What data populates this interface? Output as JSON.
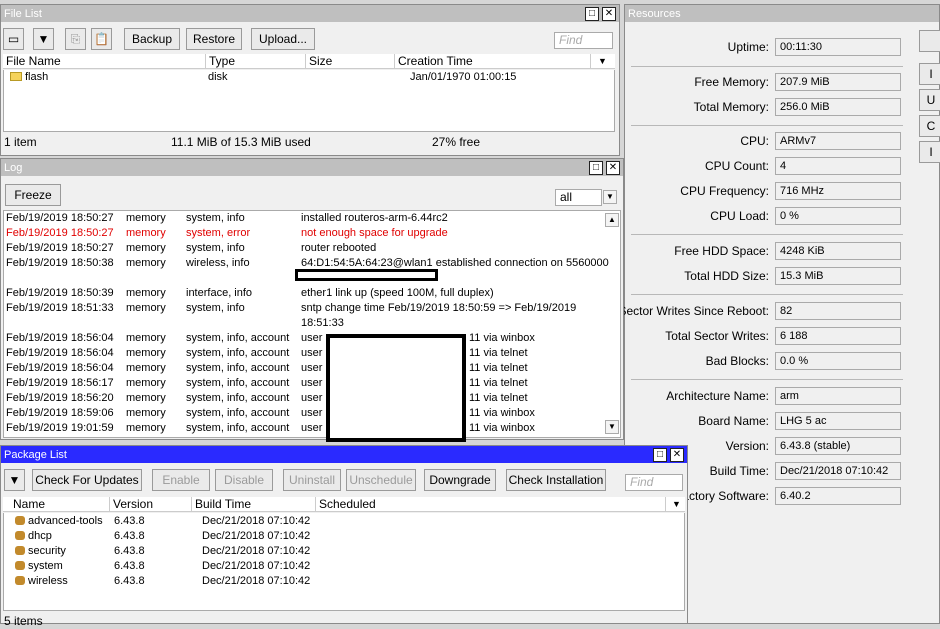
{
  "file_list": {
    "title": "File List",
    "buttons": {
      "backup": "Backup",
      "restore": "Restore",
      "upload": "Upload..."
    },
    "find_placeholder": "Find",
    "columns": [
      "File Name",
      "Type",
      "Size",
      "Creation Time"
    ],
    "rows": [
      {
        "name": "flash",
        "type": "disk",
        "size": "",
        "time": "Jan/01/1970 01:00:15"
      }
    ],
    "status": {
      "items": "1 item",
      "used": "11.1 MiB of 15.3 MiB used",
      "free": "27% free"
    }
  },
  "log": {
    "title": "Log",
    "freeze": "Freeze",
    "filter": "all",
    "rows": [
      {
        "time": "Feb/19/2019 18:50:27",
        "buffer": "memory",
        "topics": "system, info",
        "message": "installed routeros-arm-6.44rc2",
        "error": false
      },
      {
        "time": "Feb/19/2019 18:50:27",
        "buffer": "memory",
        "topics": "system, error",
        "message": "not enough space for upgrade",
        "error": true
      },
      {
        "time": "Feb/19/2019 18:50:27",
        "buffer": "memory",
        "topics": "system, info",
        "message": "router rebooted",
        "error": false
      },
      {
        "time": "Feb/19/2019 18:50:38",
        "buffer": "memory",
        "topics": "wireless, info",
        "message": "64:D1:54:5A:64:23@wlan1 established connection on 5560000",
        "error": false
      },
      {
        "time": "Feb/19/2019 18:50:39",
        "buffer": "memory",
        "topics": "interface, info",
        "message": "ether1 link up (speed 100M, full duplex)",
        "error": false
      },
      {
        "time": "Feb/19/2019 18:51:33",
        "buffer": "memory",
        "topics": "system, info",
        "message": "sntp change time Feb/19/2019 18:50:59 => Feb/19/2019",
        "message2": "18:51:33",
        "error": false
      },
      {
        "time": "Feb/19/2019 18:56:04",
        "buffer": "memory",
        "topics": "system, info, account",
        "message": "user a",
        "tail": "11 via winbox",
        "error": false
      },
      {
        "time": "Feb/19/2019 18:56:04",
        "buffer": "memory",
        "topics": "system, info, account",
        "message": "user a",
        "tail": "11 via telnet",
        "error": false
      },
      {
        "time": "Feb/19/2019 18:56:04",
        "buffer": "memory",
        "topics": "system, info, account",
        "message": "user a",
        "tail": "11 via telnet",
        "error": false
      },
      {
        "time": "Feb/19/2019 18:56:17",
        "buffer": "memory",
        "topics": "system, info, account",
        "message": "user a",
        "tail": "11 via telnet",
        "error": false
      },
      {
        "time": "Feb/19/2019 18:56:20",
        "buffer": "memory",
        "topics": "system, info, account",
        "message": "user a",
        "tail": "11 via telnet",
        "error": false
      },
      {
        "time": "Feb/19/2019 18:59:06",
        "buffer": "memory",
        "topics": "system, info, account",
        "message": "user a",
        "tail": "11 via winbox",
        "error": false
      },
      {
        "time": "Feb/19/2019 19:01:59",
        "buffer": "memory",
        "topics": "system, info, account",
        "message": "user a",
        "tail": "11 via winbox",
        "error": false
      }
    ]
  },
  "package_list": {
    "title": "Package List",
    "buttons": {
      "check_updates": "Check For Updates",
      "enable": "Enable",
      "disable": "Disable",
      "uninstall": "Uninstall",
      "unschedule": "Unschedule",
      "downgrade": "Downgrade",
      "check_installation": "Check Installation"
    },
    "find_placeholder": "Find",
    "columns": [
      "Name",
      "Version",
      "Build Time",
      "Scheduled"
    ],
    "rows": [
      {
        "name": "advanced-tools",
        "version": "6.43.8",
        "build": "Dec/21/2018 07:10:42",
        "scheduled": ""
      },
      {
        "name": "dhcp",
        "version": "6.43.8",
        "build": "Dec/21/2018 07:10:42",
        "scheduled": ""
      },
      {
        "name": "security",
        "version": "6.43.8",
        "build": "Dec/21/2018 07:10:42",
        "scheduled": ""
      },
      {
        "name": "system",
        "version": "6.43.8",
        "build": "Dec/21/2018 07:10:42",
        "scheduled": ""
      },
      {
        "name": "wireless",
        "version": "6.43.8",
        "build": "Dec/21/2018 07:10:42",
        "scheduled": ""
      }
    ],
    "status": "5 items"
  },
  "resources": {
    "title": "Resources",
    "fields": [
      {
        "label": "Uptime:",
        "value": "00:11:30"
      },
      {
        "label": "Free Memory:",
        "value": "207.9 MiB"
      },
      {
        "label": "Total Memory:",
        "value": "256.0 MiB"
      },
      {
        "label": "CPU:",
        "value": "ARMv7"
      },
      {
        "label": "CPU Count:",
        "value": "4"
      },
      {
        "label": "CPU Frequency:",
        "value": "716 MHz"
      },
      {
        "label": "CPU Load:",
        "value": "0 %"
      },
      {
        "label": "Free HDD Space:",
        "value": "4248 KiB"
      },
      {
        "label": "Total HDD Size:",
        "value": "15.3 MiB"
      },
      {
        "label": "Sector Writes Since Reboot:",
        "value": "82"
      },
      {
        "label": "Total Sector Writes:",
        "value": "6 188"
      },
      {
        "label": "Bad Blocks:",
        "value": "0.0 %"
      },
      {
        "label": "Architecture Name:",
        "value": "arm"
      },
      {
        "label": "Board Name:",
        "value": "LHG 5 ac"
      },
      {
        "label": "Version:",
        "value": "6.43.8 (stable)"
      },
      {
        "label": "Build Time:",
        "value": "Dec/21/2018 07:10:42"
      },
      {
        "label": "Factory Software:",
        "value": "6.40.2"
      }
    ],
    "side_buttons": [
      "",
      "I",
      "U",
      "C",
      "I"
    ]
  }
}
